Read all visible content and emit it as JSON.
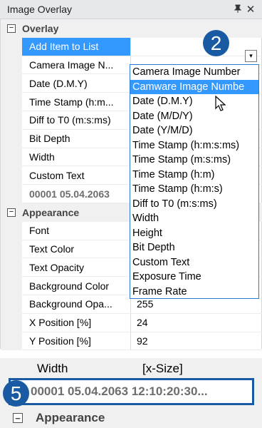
{
  "panel": {
    "title": "Image Overlay",
    "pin_glyph": "p",
    "close_glyph": "✕"
  },
  "rows": [
    {
      "type": "category",
      "name": "Overlay",
      "toggle": "−"
    },
    {
      "type": "prop",
      "name": "Add Item to List",
      "value": "",
      "selected": true
    },
    {
      "type": "prop",
      "name": "Camera Image N...",
      "value": ""
    },
    {
      "type": "prop",
      "name": "Date (D.M.Y)",
      "value": ""
    },
    {
      "type": "prop",
      "name": "Time Stamp (h:m...",
      "value": ""
    },
    {
      "type": "prop",
      "name": "Diff to T0 (m:s:ms)",
      "value": ""
    },
    {
      "type": "prop",
      "name": "Bit Depth",
      "value": ""
    },
    {
      "type": "prop",
      "name": "Width",
      "value": ""
    },
    {
      "type": "prop",
      "name": "Custom Text",
      "value": ""
    },
    {
      "type": "prop",
      "name": "00001 05.04.2063",
      "value": "",
      "grey": true
    },
    {
      "type": "category",
      "name": "Appearance",
      "toggle": "−"
    },
    {
      "type": "prop",
      "name": "Font",
      "value": ""
    },
    {
      "type": "prop",
      "name": "Text Color",
      "value": ""
    },
    {
      "type": "prop",
      "name": "Text Opacity",
      "value": ""
    },
    {
      "type": "prop",
      "name": "Background Color",
      "value": ""
    },
    {
      "type": "prop",
      "name": "Background Opa...",
      "value": "255"
    },
    {
      "type": "prop",
      "name": "X Position [%]",
      "value": "24"
    },
    {
      "type": "prop",
      "name": "Y Position [%]",
      "value": "92"
    }
  ],
  "dropdown": {
    "arrow_glyph": "▾",
    "items": [
      "Camera Image Number",
      "Camware Image Numbe",
      "Date (D.M.Y)",
      "Date (M/D/Y)",
      "Date (Y/M/D)",
      "Time Stamp (h:m:s:ms)",
      "Time Stamp (m:s:ms)",
      "Time Stamp (h:m)",
      "Time Stamp (h:m:s)",
      "Diff to T0 (m:s:ms)",
      "Width",
      "Height",
      "Bit Depth",
      "Custom Text",
      "Exposure Time",
      "Frame Rate"
    ],
    "highlighted_index": 1
  },
  "badges": {
    "two": "2",
    "five": "5"
  },
  "zoom": {
    "width_name": "Width",
    "width_value": "[x-Size]",
    "overlay_text": "00001 05.04.2063 12:10:20:30...",
    "category": "Appearance",
    "toggle": "−"
  },
  "colors": {
    "accent": "#1a5aa3",
    "selection": "#3399ff"
  }
}
